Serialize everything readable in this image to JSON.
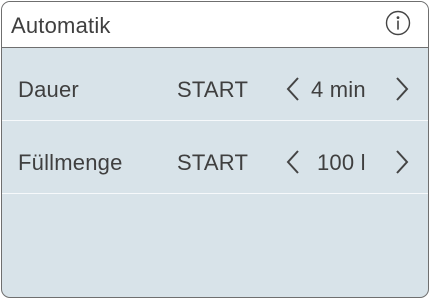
{
  "header": {
    "title": "Automatik",
    "info_icon": "info-icon"
  },
  "settings": [
    {
      "label": "Dauer",
      "start_label": "START",
      "value": "4 min",
      "decrease_icon": "chevron-left-icon",
      "increase_icon": "chevron-right-icon"
    },
    {
      "label": "Füllmenge",
      "start_label": "START",
      "value": "100 l",
      "decrease_icon": "chevron-left-icon",
      "increase_icon": "chevron-right-icon"
    }
  ],
  "colors": {
    "header_bg": "#ffffff",
    "panel_bg": "#d8e3e9",
    "text": "#3f3f3f",
    "border": "#6f6f6f"
  }
}
